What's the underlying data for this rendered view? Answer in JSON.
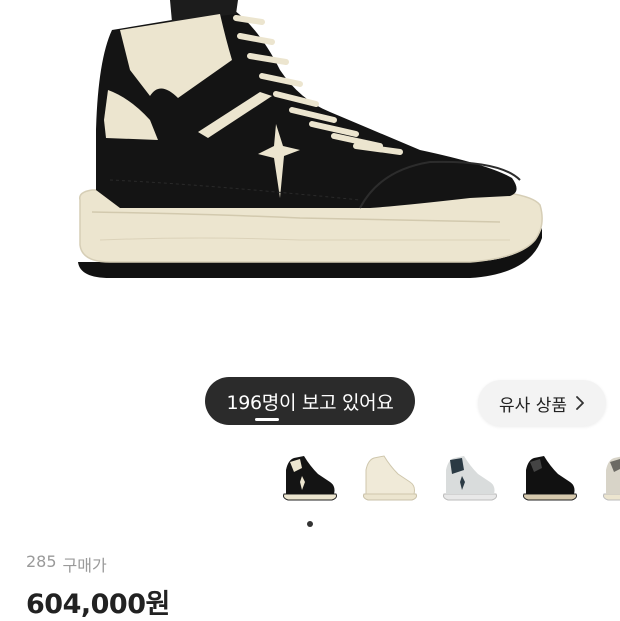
{
  "product": {
    "image_alt": "high-top sneaker, black leather with cream sole",
    "colors": {
      "leather": "#141414",
      "cream": "#ece5cf",
      "sole_bottom": "#111111"
    }
  },
  "viewers_pill": {
    "text": "196명이 보고 있어요"
  },
  "similar_button": {
    "label": "유사 상품",
    "icon": "chevron-right-icon"
  },
  "thumbnails": [
    {
      "variant": "black-cream",
      "selected": true
    },
    {
      "variant": "all-cream",
      "selected": false
    },
    {
      "variant": "grey-white",
      "selected": false
    },
    {
      "variant": "black-cream",
      "selected": false
    },
    {
      "variant": "cream-partial",
      "selected": false
    }
  ],
  "pagination": {
    "current": 1
  },
  "price_block": {
    "size": "285",
    "type_label": "구매가",
    "price": "604,000원"
  }
}
